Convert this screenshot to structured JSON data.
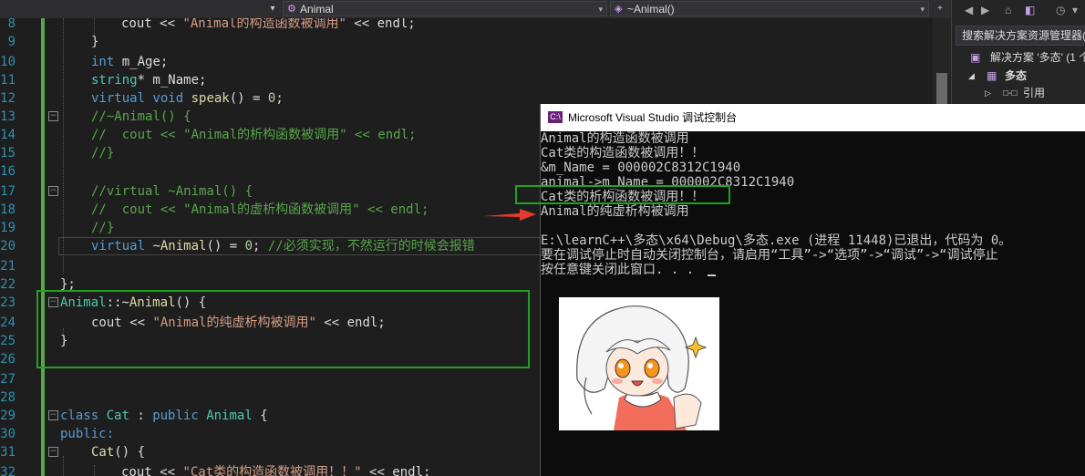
{
  "navbar": {
    "class_dropdown": "Animal",
    "class_icon": "class-icon",
    "member_dropdown": "~Animal()",
    "member_icon": "method-icon"
  },
  "editor": {
    "lines": [
      {
        "n": "8",
        "text": "cout << \"Animal的构造函数被调用\" << endl;"
      },
      {
        "n": "9",
        "text": "}"
      },
      {
        "n": "10",
        "text": "int m_Age;"
      },
      {
        "n": "11",
        "text": "string* m_Name;"
      },
      {
        "n": "12",
        "text": "virtual void speak() = 0;"
      },
      {
        "n": "13",
        "text": "//~Animal() {"
      },
      {
        "n": "14",
        "text": "//  cout << \"Animal的析构函数被调用\" << endl;"
      },
      {
        "n": "15",
        "text": "//}"
      },
      {
        "n": "16",
        "text": ""
      },
      {
        "n": "17",
        "text": "//virtual ~Animal() {"
      },
      {
        "n": "18",
        "text": "//  cout << \"Animal的虚析构函数被调用\" << endl;"
      },
      {
        "n": "19",
        "text": "//}"
      },
      {
        "n": "20",
        "text": "virtual ~Animal() = 0; //必须实现，不然运行的时候会报错"
      },
      {
        "n": "21",
        "text": ""
      },
      {
        "n": "22",
        "text": "};"
      },
      {
        "n": "23",
        "text": "Animal::~Animal() {"
      },
      {
        "n": "24",
        "text": "cout << \"Animal的纯虚析构被调用\" << endl;"
      },
      {
        "n": "25",
        "text": "}"
      },
      {
        "n": "26",
        "text": ""
      },
      {
        "n": "27",
        "text": ""
      },
      {
        "n": "28",
        "text": ""
      },
      {
        "n": "29",
        "text": "class Cat : public Animal {"
      },
      {
        "n": "30",
        "text": "public:"
      },
      {
        "n": "31",
        "text": "Cat() {"
      },
      {
        "n": "32",
        "text": "cout << \"Cat类的构造函数被调用！！\" << endl;"
      }
    ]
  },
  "solution_explorer": {
    "search_placeholder": "搜索解决方案资源管理器(",
    "solution_label": "解决方案 '多态' (1 个",
    "project_label": "多态",
    "references_label": "引用"
  },
  "console": {
    "title": "Microsoft Visual Studio 调试控制台",
    "lines": [
      "Animal的构造函数被调用",
      "Cat类的构造函数被调用！！",
      "&m_Name = 000002C8312C1940",
      "animal->m_Name = 000002C8312C1940",
      "Cat类的析构函数被调用！！",
      "Animal的纯虚析构被调用",
      "",
      "E:\\learnC++\\多态\\x64\\Debug\\多态.exe (进程 11448)已退出，代码为 0。",
      "要在调试停止时自动关闭控制台，请启用“工具”->“选项”->“调试”->“调试停止",
      "按任意键关闭此窗口. . ."
    ]
  },
  "colors": {
    "annotation_box": "#1fa31f",
    "annotation_arrow": "#e53a2e",
    "editor_bg": "#1e1e1e",
    "console_bg": "#0c0c0c"
  }
}
